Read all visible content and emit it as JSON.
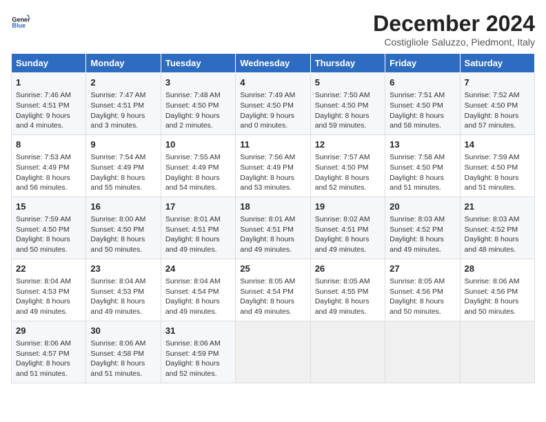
{
  "logo": {
    "line1": "General",
    "line2": "Blue"
  },
  "title": "December 2024",
  "subtitle": "Costigliole Saluzzo, Piedmont, Italy",
  "days_of_week": [
    "Sunday",
    "Monday",
    "Tuesday",
    "Wednesday",
    "Thursday",
    "Friday",
    "Saturday"
  ],
  "weeks": [
    [
      {
        "day": 1,
        "sunrise": "7:46 AM",
        "sunset": "4:51 PM",
        "daylight": "9 hours and 4 minutes."
      },
      {
        "day": 2,
        "sunrise": "7:47 AM",
        "sunset": "4:51 PM",
        "daylight": "9 hours and 3 minutes."
      },
      {
        "day": 3,
        "sunrise": "7:48 AM",
        "sunset": "4:50 PM",
        "daylight": "9 hours and 2 minutes."
      },
      {
        "day": 4,
        "sunrise": "7:49 AM",
        "sunset": "4:50 PM",
        "daylight": "9 hours and 0 minutes."
      },
      {
        "day": 5,
        "sunrise": "7:50 AM",
        "sunset": "4:50 PM",
        "daylight": "8 hours and 59 minutes."
      },
      {
        "day": 6,
        "sunrise": "7:51 AM",
        "sunset": "4:50 PM",
        "daylight": "8 hours and 58 minutes."
      },
      {
        "day": 7,
        "sunrise": "7:52 AM",
        "sunset": "4:50 PM",
        "daylight": "8 hours and 57 minutes."
      }
    ],
    [
      {
        "day": 8,
        "sunrise": "7:53 AM",
        "sunset": "4:49 PM",
        "daylight": "8 hours and 56 minutes."
      },
      {
        "day": 9,
        "sunrise": "7:54 AM",
        "sunset": "4:49 PM",
        "daylight": "8 hours and 55 minutes."
      },
      {
        "day": 10,
        "sunrise": "7:55 AM",
        "sunset": "4:49 PM",
        "daylight": "8 hours and 54 minutes."
      },
      {
        "day": 11,
        "sunrise": "7:56 AM",
        "sunset": "4:49 PM",
        "daylight": "8 hours and 53 minutes."
      },
      {
        "day": 12,
        "sunrise": "7:57 AM",
        "sunset": "4:50 PM",
        "daylight": "8 hours and 52 minutes."
      },
      {
        "day": 13,
        "sunrise": "7:58 AM",
        "sunset": "4:50 PM",
        "daylight": "8 hours and 51 minutes."
      },
      {
        "day": 14,
        "sunrise": "7:59 AM",
        "sunset": "4:50 PM",
        "daylight": "8 hours and 51 minutes."
      }
    ],
    [
      {
        "day": 15,
        "sunrise": "7:59 AM",
        "sunset": "4:50 PM",
        "daylight": "8 hours and 50 minutes."
      },
      {
        "day": 16,
        "sunrise": "8:00 AM",
        "sunset": "4:50 PM",
        "daylight": "8 hours and 50 minutes."
      },
      {
        "day": 17,
        "sunrise": "8:01 AM",
        "sunset": "4:51 PM",
        "daylight": "8 hours and 49 minutes."
      },
      {
        "day": 18,
        "sunrise": "8:01 AM",
        "sunset": "4:51 PM",
        "daylight": "8 hours and 49 minutes."
      },
      {
        "day": 19,
        "sunrise": "8:02 AM",
        "sunset": "4:51 PM",
        "daylight": "8 hours and 49 minutes."
      },
      {
        "day": 20,
        "sunrise": "8:03 AM",
        "sunset": "4:52 PM",
        "daylight": "8 hours and 49 minutes."
      },
      {
        "day": 21,
        "sunrise": "8:03 AM",
        "sunset": "4:52 PM",
        "daylight": "8 hours and 48 minutes."
      }
    ],
    [
      {
        "day": 22,
        "sunrise": "8:04 AM",
        "sunset": "4:53 PM",
        "daylight": "8 hours and 49 minutes."
      },
      {
        "day": 23,
        "sunrise": "8:04 AM",
        "sunset": "4:53 PM",
        "daylight": "8 hours and 49 minutes."
      },
      {
        "day": 24,
        "sunrise": "8:04 AM",
        "sunset": "4:54 PM",
        "daylight": "8 hours and 49 minutes."
      },
      {
        "day": 25,
        "sunrise": "8:05 AM",
        "sunset": "4:54 PM",
        "daylight": "8 hours and 49 minutes."
      },
      {
        "day": 26,
        "sunrise": "8:05 AM",
        "sunset": "4:55 PM",
        "daylight": "8 hours and 49 minutes."
      },
      {
        "day": 27,
        "sunrise": "8:05 AM",
        "sunset": "4:56 PM",
        "daylight": "8 hours and 50 minutes."
      },
      {
        "day": 28,
        "sunrise": "8:06 AM",
        "sunset": "4:56 PM",
        "daylight": "8 hours and 50 minutes."
      }
    ],
    [
      {
        "day": 29,
        "sunrise": "8:06 AM",
        "sunset": "4:57 PM",
        "daylight": "8 hours and 51 minutes."
      },
      {
        "day": 30,
        "sunrise": "8:06 AM",
        "sunset": "4:58 PM",
        "daylight": "8 hours and 51 minutes."
      },
      {
        "day": 31,
        "sunrise": "8:06 AM",
        "sunset": "4:59 PM",
        "daylight": "8 hours and 52 minutes."
      },
      null,
      null,
      null,
      null
    ]
  ]
}
